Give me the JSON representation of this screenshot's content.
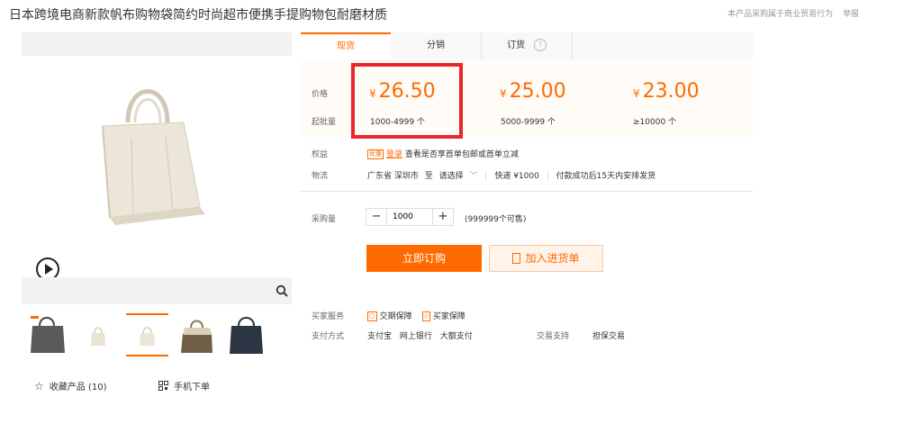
{
  "header": {
    "title": "日本跨境电商新款帆布购物袋简约时尚超市便携手提购物包耐磨材质",
    "notice": "本产品采购属于商业贸易行为",
    "report": "举报"
  },
  "tabs": [
    {
      "label": "现货"
    },
    {
      "label": "分销"
    },
    {
      "label": "订货"
    }
  ],
  "pricing": {
    "price_label": "价格",
    "moq_label": "起批量",
    "currency": "¥",
    "tiers": [
      {
        "price": "26.50",
        "range": "1000-4999 个"
      },
      {
        "price": "25.00",
        "range": "5000-9999 个"
      },
      {
        "price": "23.00",
        "range": "≥10000 个"
      }
    ]
  },
  "benefits": {
    "label": "权益",
    "badge": "优惠",
    "link": "登录",
    "text": "查看是否享首单包邮或首单立减"
  },
  "logistics": {
    "label": "物流",
    "origin": "广东省 深圳市",
    "to": "至",
    "destination": "请选择",
    "shipping": "快递 ¥1000",
    "delivery": "付款成功后15天内安排发货"
  },
  "purchase": {
    "label": "采购量",
    "minus": "−",
    "quantity": "1000",
    "plus": "+",
    "stock": "(999999个可售)",
    "buy_now": "立即订购",
    "add_to_cart": "加入进货单"
  },
  "service": {
    "label": "买家服务",
    "item1": "交期保障",
    "item2": "买家保障"
  },
  "payment": {
    "label": "支付方式",
    "methods": [
      "支付宝",
      "网上银行",
      "大额支付"
    ],
    "support_label": "交易支持",
    "support": "担保交易"
  },
  "footer": {
    "favorite": "收藏产品 (10)",
    "mobile_order": "手机下单"
  },
  "colors": {
    "accent": "#ff6a00",
    "highlight": "#e8262b"
  }
}
